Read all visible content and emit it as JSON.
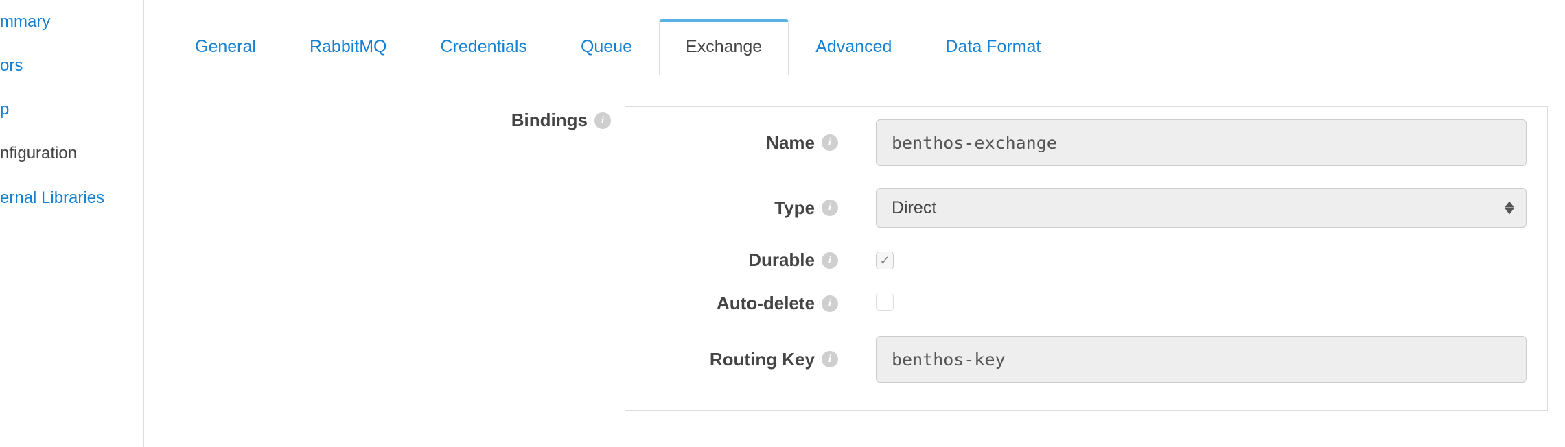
{
  "sidebar": {
    "items": [
      {
        "label": "mmary"
      },
      {
        "label": "ors"
      },
      {
        "label": "p"
      }
    ],
    "static": "nfiguration",
    "external": "ernal Libraries"
  },
  "tabs": [
    {
      "label": "General",
      "active": false
    },
    {
      "label": "RabbitMQ",
      "active": false
    },
    {
      "label": "Credentials",
      "active": false
    },
    {
      "label": "Queue",
      "active": false
    },
    {
      "label": "Exchange",
      "active": true
    },
    {
      "label": "Advanced",
      "active": false
    },
    {
      "label": "Data Format",
      "active": false
    }
  ],
  "section": {
    "bindings": "Bindings"
  },
  "form": {
    "name": {
      "label": "Name",
      "value": "benthos-exchange"
    },
    "type": {
      "label": "Type",
      "value": "Direct"
    },
    "durable": {
      "label": "Durable",
      "checked": true
    },
    "autodelete": {
      "label": "Auto-delete",
      "checked": false
    },
    "routingkey": {
      "label": "Routing Key",
      "value": "benthos-key"
    }
  }
}
